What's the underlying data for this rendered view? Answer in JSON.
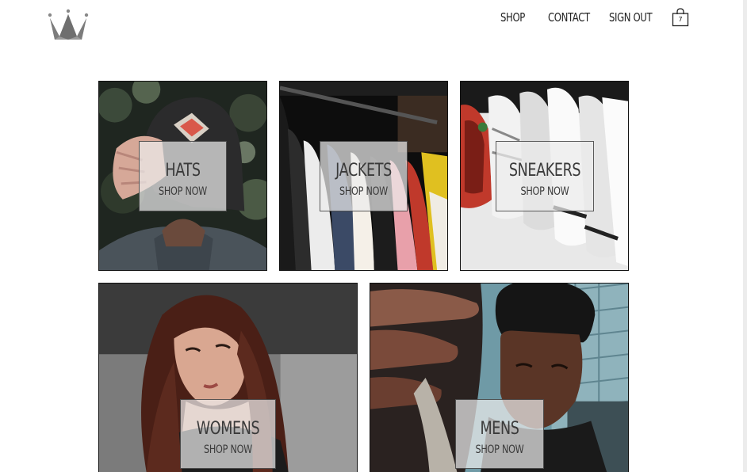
{
  "header": {
    "logo": "crown-logo-icon",
    "nav": [
      {
        "label": "SHOP"
      },
      {
        "label": "CONTACT"
      },
      {
        "label": "SIGN OUT"
      }
    ],
    "cart": {
      "icon": "shopping-bag-icon",
      "count": "7"
    }
  },
  "directory": {
    "sections": [
      {
        "title": "HATS",
        "cta": "SHOP NOW"
      },
      {
        "title": "JACKETS",
        "cta": "SHOP NOW"
      },
      {
        "title": "SNEAKERS",
        "cta": "SHOP NOW"
      },
      {
        "title": "WOMENS",
        "cta": "SHOP NOW"
      },
      {
        "title": "MENS",
        "cta": "SHOP NOW"
      }
    ]
  },
  "colors": {
    "text": "#222222",
    "label_bg": "#ebebeb",
    "border": "#111111"
  }
}
